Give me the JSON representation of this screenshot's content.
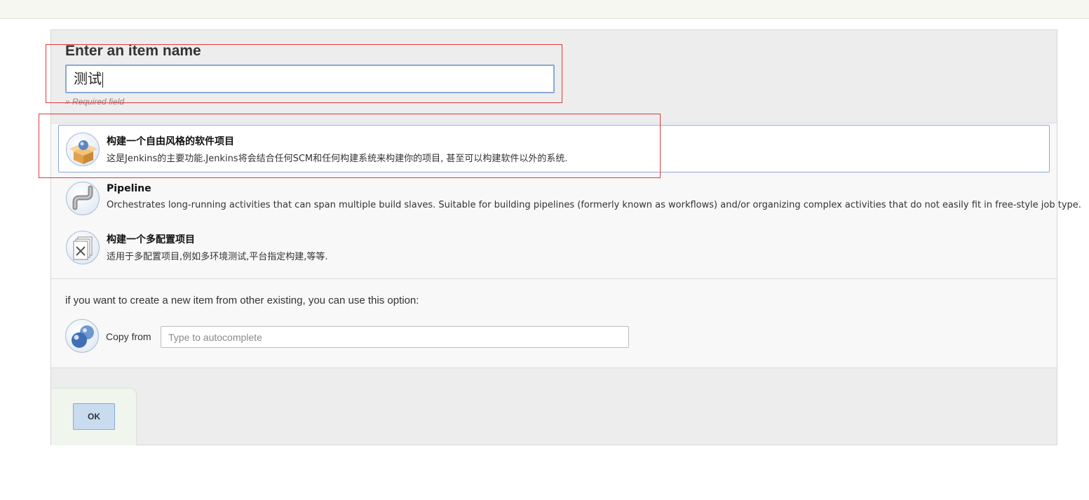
{
  "item_name": {
    "title": "Enter an item name",
    "value": "测试",
    "required_note": "» Required field"
  },
  "project_types": [
    {
      "label": "构建一个自由风格的软件项目",
      "description": "这是Jenkins的主要功能.Jenkins将会结合任何SCM和任何构建系统来构建你的项目, 甚至可以构建软件以外的系统.",
      "icon": "freestyle-box-icon",
      "selected": true
    },
    {
      "label": "Pipeline",
      "description": "Orchestrates long-running activities that can span multiple build slaves. Suitable for building pipelines (formerly known as workflows) and/or organizing complex activities that do not easily fit in free-style job type.",
      "icon": "pipeline-icon",
      "selected": false
    },
    {
      "label": "构建一个多配置项目",
      "description": "适用于多配置项目,例如多环境测试,平台指定构建,等等.",
      "icon": "multi-config-icon",
      "selected": false
    }
  ],
  "copy": {
    "hint": "if you want to create a new item from other existing, you can use this option:",
    "label": "Copy from",
    "placeholder": "Type to autocomplete",
    "icon": "copy-item-icon"
  },
  "ok_button": {
    "label": "OK"
  },
  "colors": {
    "annotation": "#e03a3a",
    "selected_border": "#8aa9d4",
    "ok_button_bg": "#c9dbef"
  }
}
